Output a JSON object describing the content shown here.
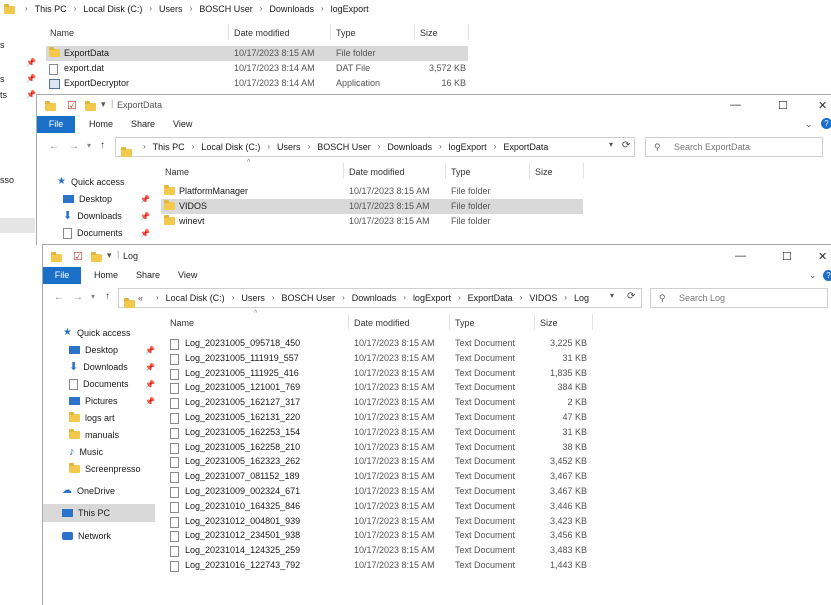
{
  "win1": {
    "breadcrumb": [
      "This PC",
      "Local Disk (C:)",
      "Users",
      "BOSCH User",
      "Downloads",
      "logExport"
    ],
    "columns": [
      "Name",
      "Date modified",
      "Type",
      "Size"
    ],
    "rows": [
      {
        "name": "ExportData",
        "date": "10/17/2023 8:15 AM",
        "type": "File folder",
        "size": "",
        "icon": "folder-icon"
      },
      {
        "name": "export.dat",
        "date": "10/17/2023 8:14 AM",
        "type": "DAT File",
        "size": "3,572 KB",
        "icon": "file-icon"
      },
      {
        "name": "ExportDecryptor",
        "date": "10/17/2023 8:14 AM",
        "type": "Application",
        "size": "16 KB",
        "icon": "app-icon"
      }
    ],
    "left_fragments": [
      "s",
      "s",
      "ts",
      "sso"
    ]
  },
  "win2": {
    "title": "ExportData",
    "ribbon": {
      "file": "File",
      "home": "Home",
      "share": "Share",
      "view": "View"
    },
    "breadcrumb": [
      "This PC",
      "Local Disk (C:)",
      "Users",
      "BOSCH User",
      "Downloads",
      "logExport",
      "ExportData"
    ],
    "search_placeholder": "Search ExportData",
    "columns": [
      "Name",
      "Date modified",
      "Type",
      "Size"
    ],
    "nav": {
      "quick_access": "Quick access",
      "items": [
        "Desktop",
        "Downloads",
        "Documents"
      ]
    },
    "rows": [
      {
        "name": "PlatformManager",
        "date": "10/17/2023 8:15 AM",
        "type": "File folder"
      },
      {
        "name": "VIDOS",
        "date": "10/17/2023 8:15 AM",
        "type": "File folder"
      },
      {
        "name": "winevt",
        "date": "10/17/2023 8:15 AM",
        "type": "File folder"
      }
    ]
  },
  "win3": {
    "title": "Log",
    "ribbon": {
      "file": "File",
      "home": "Home",
      "share": "Share",
      "view": "View"
    },
    "breadcrumb_prefix": "«",
    "breadcrumb": [
      "Local Disk (C:)",
      "Users",
      "BOSCH User",
      "Downloads",
      "logExport",
      "ExportData",
      "VIDOS",
      "Log"
    ],
    "search_placeholder": "Search Log",
    "columns": [
      "Name",
      "Date modified",
      "Type",
      "Size"
    ],
    "nav": {
      "quick_access": "Quick access",
      "items": [
        {
          "label": "Desktop",
          "icon": "desktop-icon",
          "pinned": true
        },
        {
          "label": "Downloads",
          "icon": "download-icon",
          "pinned": true
        },
        {
          "label": "Documents",
          "icon": "documents-icon",
          "pinned": true
        },
        {
          "label": "Pictures",
          "icon": "pictures-icon",
          "pinned": true
        },
        {
          "label": "logs art",
          "icon": "folder-icon",
          "pinned": false
        },
        {
          "label": "manuals",
          "icon": "folder-icon",
          "pinned": false
        },
        {
          "label": "Music",
          "icon": "music-icon",
          "pinned": false
        },
        {
          "label": "Screenpresso",
          "icon": "folder-icon",
          "pinned": false
        }
      ],
      "onedrive": "OneDrive",
      "this_pc": "This PC",
      "network": "Network"
    },
    "rows": [
      {
        "name": "Log_20231005_095718_450",
        "date": "10/17/2023 8:15 AM",
        "type": "Text Document",
        "size": "3,225 KB"
      },
      {
        "name": "Log_20231005_111919_557",
        "date": "10/17/2023 8:15 AM",
        "type": "Text Document",
        "size": "31 KB"
      },
      {
        "name": "Log_20231005_111925_416",
        "date": "10/17/2023 8:15 AM",
        "type": "Text Document",
        "size": "1,835 KB"
      },
      {
        "name": "Log_20231005_121001_769",
        "date": "10/17/2023 8:15 AM",
        "type": "Text Document",
        "size": "384 KB"
      },
      {
        "name": "Log_20231005_162127_317",
        "date": "10/17/2023 8:15 AM",
        "type": "Text Document",
        "size": "2 KB"
      },
      {
        "name": "Log_20231005_162131_220",
        "date": "10/17/2023 8:15 AM",
        "type": "Text Document",
        "size": "47 KB"
      },
      {
        "name": "Log_20231005_162253_154",
        "date": "10/17/2023 8:15 AM",
        "type": "Text Document",
        "size": "31 KB"
      },
      {
        "name": "Log_20231005_162258_210",
        "date": "10/17/2023 8:15 AM",
        "type": "Text Document",
        "size": "38 KB"
      },
      {
        "name": "Log_20231005_162323_262",
        "date": "10/17/2023 8:15 AM",
        "type": "Text Document",
        "size": "3,452 KB"
      },
      {
        "name": "Log_20231007_081152_189",
        "date": "10/17/2023 8:15 AM",
        "type": "Text Document",
        "size": "3,467 KB"
      },
      {
        "name": "Log_20231009_002324_671",
        "date": "10/17/2023 8:15 AM",
        "type": "Text Document",
        "size": "3,467 KB"
      },
      {
        "name": "Log_20231010_164325_846",
        "date": "10/17/2023 8:15 AM",
        "type": "Text Document",
        "size": "3,446 KB"
      },
      {
        "name": "Log_20231012_004801_939",
        "date": "10/17/2023 8:15 AM",
        "type": "Text Document",
        "size": "3,423 KB"
      },
      {
        "name": "Log_20231012_234501_938",
        "date": "10/17/2023 8:15 AM",
        "type": "Text Document",
        "size": "3,456 KB"
      },
      {
        "name": "Log_20231014_124325_259",
        "date": "10/17/2023 8:15 AM",
        "type": "Text Document",
        "size": "3,483 KB"
      },
      {
        "name": "Log_20231016_122743_792",
        "date": "10/17/2023 8:15 AM",
        "type": "Text Document",
        "size": "1,443 KB"
      }
    ]
  },
  "colors": {
    "file_tab": "#1a6fc9",
    "selection": "#d9d9d9",
    "folder": "#f2c94c"
  }
}
